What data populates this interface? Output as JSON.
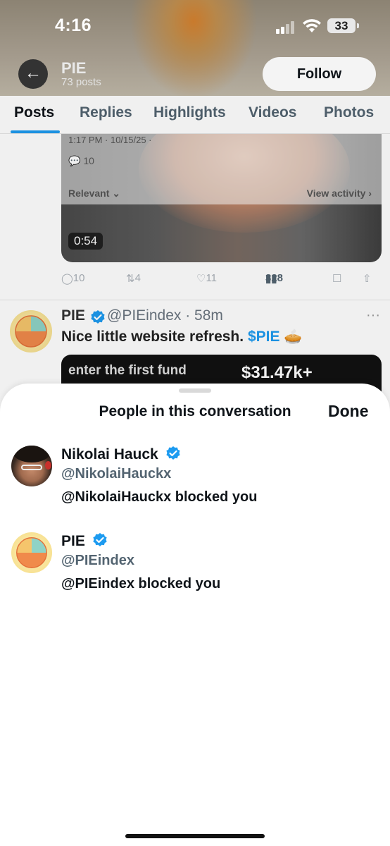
{
  "status_bar": {
    "time": "4:16",
    "battery": "33"
  },
  "profile_header": {
    "name": "PIE",
    "posts_count": "73 posts",
    "follow_label": "Follow"
  },
  "tabs": [
    {
      "label": "Posts",
      "active": true
    },
    {
      "label": "Replies"
    },
    {
      "label": "Highlights"
    },
    {
      "label": "Videos"
    },
    {
      "label": "Photos"
    }
  ],
  "post1": {
    "timestamp": "1:17 PM · 10/15/25 ·",
    "reply_count_inner": "10",
    "relevant_label": "Relevant",
    "view_activity_label": "View activity",
    "duration": "0:54",
    "replies": "10",
    "reposts": "4",
    "likes": "11",
    "views": "328"
  },
  "post2": {
    "name": "PIE",
    "handle_time": "@PIEindex · 58m",
    "text": "Nice little website refresh.",
    "cashtag": "$PIE",
    "card_text": "enter the first fund",
    "card_value": "$31.47k+"
  },
  "sheet": {
    "title": "People in this conversation",
    "done_label": "Done",
    "people": [
      {
        "name": "Nikolai Hauck",
        "handle": "@NikolaiHauckx",
        "status": "@NikolaiHauckx blocked you"
      },
      {
        "name": "PIE",
        "handle": "@PIEindex",
        "status": "@PIEindex blocked you"
      }
    ]
  },
  "colors": {
    "accent": "#1d9bf0",
    "text": "#0f1419",
    "secondary": "#536471"
  }
}
